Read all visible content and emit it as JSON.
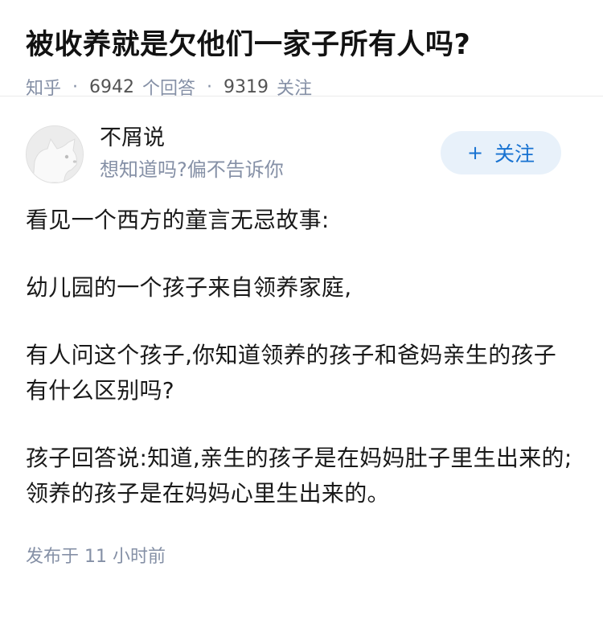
{
  "question": {
    "title": "被收养就是欠他们一家子所有人吗?",
    "source": "知乎",
    "answer_count": "6942",
    "answer_label": "个回答",
    "follow_count": "9319",
    "follow_label": "关注"
  },
  "author": {
    "name": "不屑说",
    "bio": "想知道吗?偏不告诉你",
    "avatar_icon": "dog-avatar-icon"
  },
  "follow_button": {
    "plus": "+",
    "label": "关注"
  },
  "answer": {
    "paragraphs": [
      "看见一个西方的童言无忌故事:",
      "幼儿园的一个孩子来自领养家庭,",
      "有人问这个孩子,你知道领养的孩子和爸妈亲生的孩子有什么区别吗?",
      "孩子回答说:知道,亲生的孩子是在妈妈肚子里生出来的;领养的孩子是在妈妈心里生出来的。"
    ],
    "publish_label": "发布于",
    "publish_time": "11 小时前"
  },
  "colors": {
    "accent": "#1772d1",
    "follow_bg": "#e8f1fa",
    "meta_gray": "#8590a6"
  }
}
